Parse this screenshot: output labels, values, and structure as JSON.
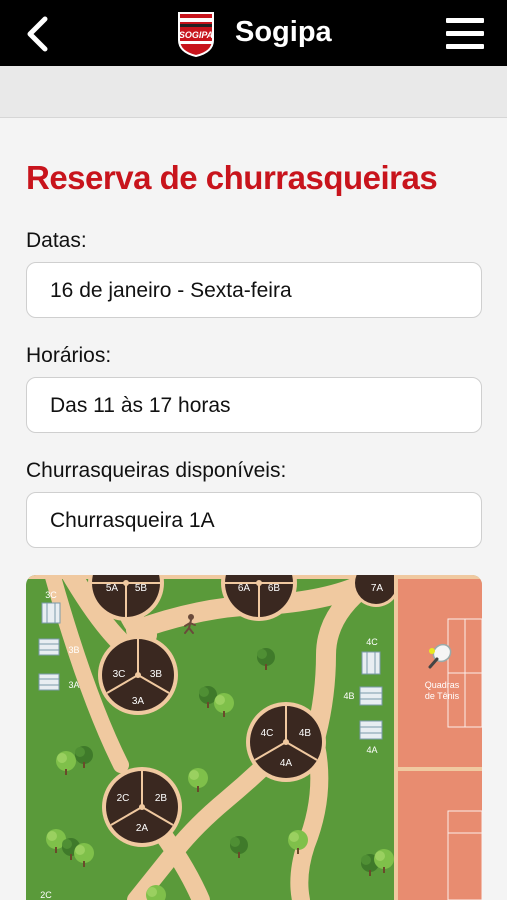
{
  "header": {
    "title": "Sogipa",
    "logo_text": "SOGIPA"
  },
  "page": {
    "title": "Reserva de churrasqueiras"
  },
  "fields": {
    "dates": {
      "label": "Datas:",
      "value": "16 de janeiro - Sexta-feira"
    },
    "times": {
      "label": "Horários:",
      "value": "Das 11 às 17 horas"
    },
    "grills": {
      "label": "Churrasqueiras disponíveis:",
      "value": "Churrasqueira 1A"
    }
  },
  "map": {
    "tennis_label": [
      "Quadras",
      "de Tênis"
    ],
    "colors": {
      "grass": "#5a9a3a",
      "path": "#f0c9a0",
      "kiosk": "#3a2820",
      "court": "#e88c70",
      "court_line": "#ffffff"
    },
    "kiosks": {
      "k5": [
        "5A",
        "5B"
      ],
      "k6": [
        "6A",
        "6B"
      ],
      "k7": [
        "7A"
      ],
      "k3": [
        "3C",
        "3B",
        "3A"
      ],
      "k4": [
        "4C",
        "4B",
        "4A"
      ],
      "k2": [
        "2C",
        "2B",
        "2A"
      ]
    },
    "tables": {
      "t3c": "3C",
      "t3b": "3B",
      "t3a": "3A",
      "t4c": "4C",
      "t4b": "4B",
      "t4a": "4A",
      "t2c": "2C"
    }
  }
}
